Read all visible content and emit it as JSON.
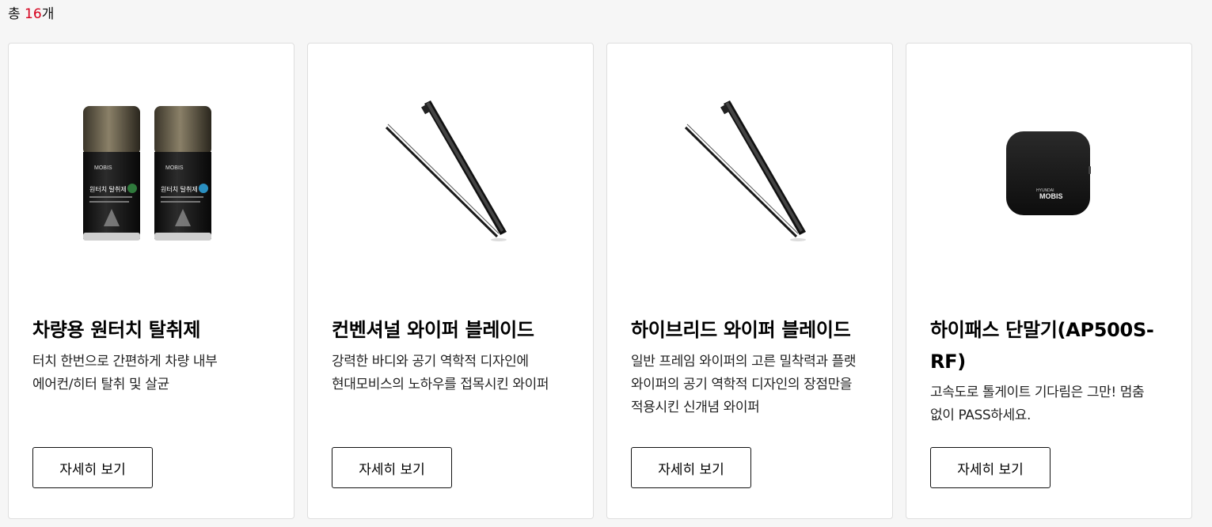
{
  "summary": {
    "prefix": "총 ",
    "count": "16",
    "suffix": "개"
  },
  "products": [
    {
      "title": "차량용 원터치 탈취제",
      "description": "터치 한번으로 간편하게 차량 내부\n에어컨/히터 탈취 및 살균",
      "button": "자세히 보기",
      "image": {
        "kind": "deodorizer-cans",
        "brand": "MOBIS",
        "can_labels": [
          "원터치 탈취제",
          "원터치 탈취제"
        ]
      }
    },
    {
      "title": "컨벤셔널 와이퍼 블레이드",
      "description": "강력한 바디와 공기 역학적 디자인에\n현대모비스의 노하우를 접목시킨 와이퍼",
      "button": "자세히 보기",
      "image": {
        "kind": "wiper-blade"
      }
    },
    {
      "title": "하이브리드 와이퍼 블레이드",
      "description": "일반 프레임 와이퍼의 고른 밀착력과 플랫\n와이퍼의 공기 역학적 디자인의 장점만을\n적용시킨 신개념 와이퍼",
      "button": "자세히 보기",
      "image": {
        "kind": "wiper-blade"
      }
    },
    {
      "title": "하이패스 단말기(AP500S-RF)",
      "description": "고속도로 톨게이트 기다림은 그만! 멈춤\n없이 PASS하세요.",
      "button": "자세히 보기",
      "image": {
        "kind": "hipass-device",
        "brand_top": "HYUNDAI",
        "brand": "MOBIS"
      }
    }
  ]
}
